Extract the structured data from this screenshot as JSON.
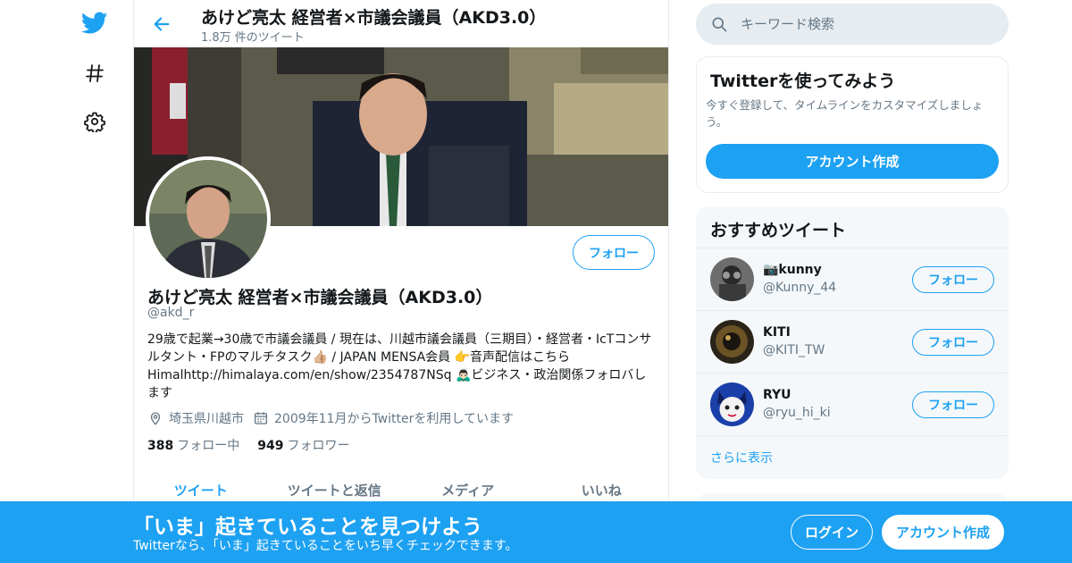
{
  "brand": {
    "accent": "#1da1f2",
    "text_secondary": "#657786",
    "border": "#e6ecf0"
  },
  "rail": {
    "items": [
      {
        "icon": "twitter-bird-icon"
      },
      {
        "icon": "hashtag-icon"
      },
      {
        "icon": "gear-icon"
      }
    ]
  },
  "header": {
    "title": "あけど亮太 経営者×市議会議員（AKD3.0）",
    "tweet_count": "1.8万 件のツイート"
  },
  "profile": {
    "follow_label": "フォロー",
    "name": "あけど亮太 経営者×市議会議員（AKD3.0）",
    "handle": "@akd_r",
    "bio": "29歳で起業→30歳で市議会議員 / 現在は、川越市議会議員（三期目）・経営者・IcTコンサルタント・FPのマルチタスク👍🏼 / JAPAN MENSA会員 👉音声配信はこちらHimalhttp://himalaya.com/en/show/2354787NSq 🙇🏻‍♂️ビジネス・政治関係フォロバします",
    "location": "埼玉県川越市",
    "joined": "2009年11月からTwitterを利用しています",
    "following_count": "388",
    "following_label": "フォロー中",
    "followers_count": "949",
    "followers_label": "フォロワー"
  },
  "tabs": [
    {
      "label": "ツイート",
      "active": true
    },
    {
      "label": "ツイートと返信",
      "active": false
    },
    {
      "label": "メディア",
      "active": false
    },
    {
      "label": "いいね",
      "active": false
    }
  ],
  "search": {
    "placeholder": "キーワード検索"
  },
  "signup_card": {
    "title": "Twitterを使ってみよう",
    "description": "今すぐ登録して、タイムラインをカスタマイズしましょう。",
    "button": "アカウント作成"
  },
  "recommended": {
    "title": "おすすめツイート",
    "users": [
      {
        "name": "📷kunny",
        "handle": "@Kunny_44",
        "follow_label": "フォロー"
      },
      {
        "name": "KITI",
        "handle": "@KITI_TW",
        "follow_label": "フォロー"
      },
      {
        "name": "RYU",
        "handle": "@ryu_hi_ki",
        "follow_label": "フォロー"
      }
    ],
    "more_label": "さらに表示"
  },
  "bottom_bar": {
    "title": "「いま」起きていることを見つけよう",
    "subtitle": "Twitterなら、「いま」起きていることをいち早くチェックできます。",
    "login": "ログイン",
    "create_account": "アカウント作成"
  }
}
